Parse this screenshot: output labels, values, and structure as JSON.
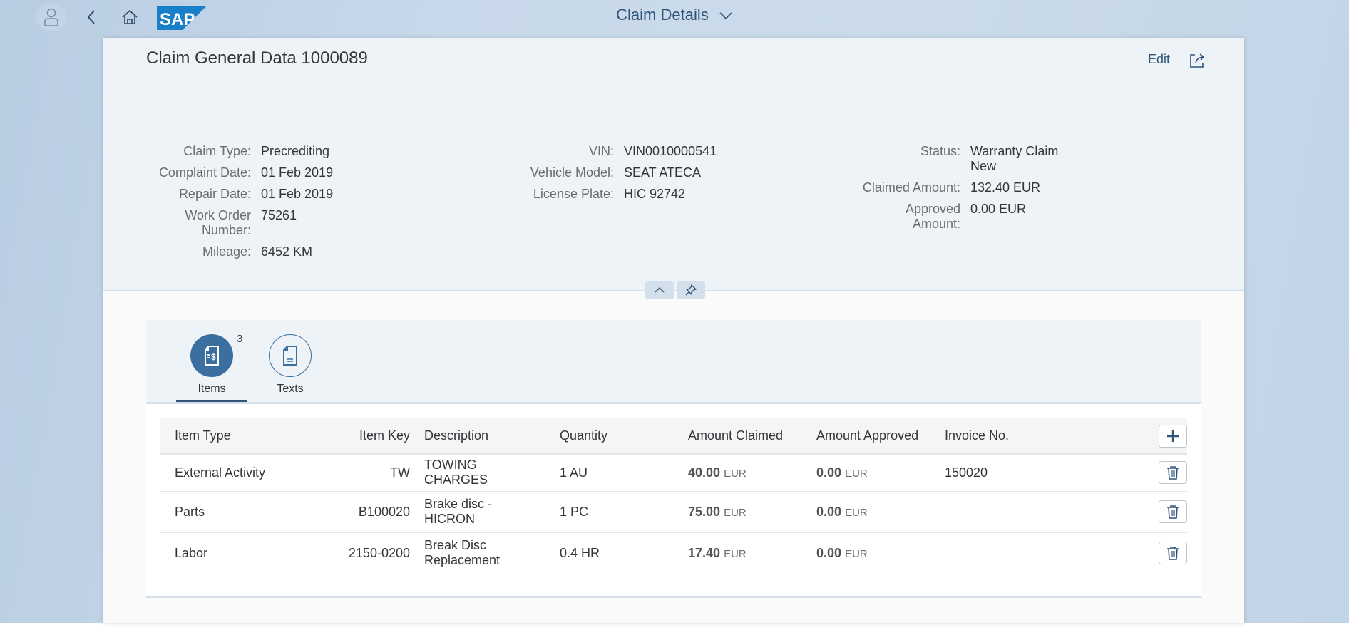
{
  "shell": {
    "title": "Claim Details",
    "logo_text": "SAP",
    "icons": {
      "avatar": "user-icon",
      "back": "chevron-left-icon",
      "home": "home-icon",
      "title_menu": "chevron-down-icon"
    }
  },
  "header": {
    "title": "Claim General Data 1000089",
    "edit_label": "Edit",
    "share_icon": "share-icon",
    "groups": [
      {
        "fields": [
          {
            "label": "Claim Type:",
            "value": "Precrediting"
          },
          {
            "label": "Complaint Date:",
            "value": "01 Feb 2019"
          },
          {
            "label": "Repair Date:",
            "value": "01 Feb 2019"
          },
          {
            "label": "Work Order Number:",
            "value": "75261"
          },
          {
            "label": "Mileage:",
            "value": "6452 KM"
          }
        ]
      },
      {
        "fields": [
          {
            "label": "VIN:",
            "value": "VIN0010000541"
          },
          {
            "label": "Vehicle Model:",
            "value": "SEAT ATECA"
          },
          {
            "label": "License Plate:",
            "value": "HIC 92742"
          }
        ]
      },
      {
        "fields": [
          {
            "label": "Status:",
            "value": "Warranty Claim New"
          },
          {
            "label": "Claimed Amount:",
            "value": "132.40 EUR"
          },
          {
            "label": "Approved Amount:",
            "value": "0.00 EUR"
          }
        ]
      }
    ],
    "collapse_icon": "chevron-up-icon",
    "pin_icon": "pin-icon"
  },
  "tabs": [
    {
      "label": "Items",
      "count": "3",
      "icon": "invoice-document-icon",
      "selected": true
    },
    {
      "label": "Texts",
      "icon": "document-text-icon",
      "selected": false
    }
  ],
  "table": {
    "columns": [
      "Item Type",
      "Item Key",
      "Description",
      "Quantity",
      "Amount Claimed",
      "Amount Approved",
      "Invoice No."
    ],
    "add_icon": "add-icon",
    "delete_icon": "delete-icon",
    "rows": [
      {
        "item_type": "External Activity",
        "item_key": "TW",
        "description": "TOWING CHARGES",
        "quantity": "1 AU",
        "amount_claimed": "40.00",
        "claimed_currency": "EUR",
        "amount_approved": "0.00",
        "approved_currency": "EUR",
        "invoice_no": "150020"
      },
      {
        "item_type": "Parts",
        "item_key": "B100020",
        "description": "Brake disc - HICRON",
        "quantity": "1 PC",
        "amount_claimed": "75.00",
        "claimed_currency": "EUR",
        "amount_approved": "0.00",
        "approved_currency": "EUR",
        "invoice_no": ""
      },
      {
        "item_type": "Labor",
        "item_key": "2150-0200",
        "description": "Break Disc Replacement",
        "quantity": "0.4 HR",
        "amount_claimed": "17.40",
        "claimed_currency": "EUR",
        "amount_approved": "0.00",
        "approved_currency": "EUR",
        "invoice_no": ""
      }
    ]
  },
  "colors": {
    "brand": "#1a7fc9",
    "accent": "#3b6fa0",
    "title_text": "#2f5478"
  }
}
